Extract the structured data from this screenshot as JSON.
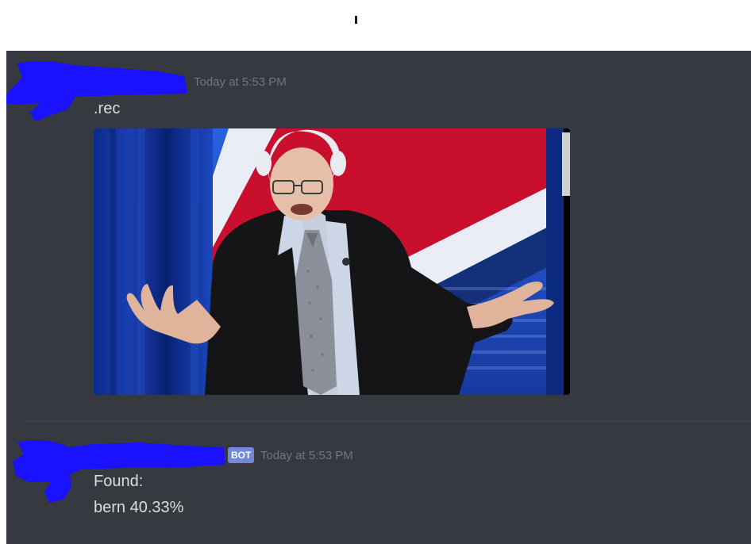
{
  "messages": [
    {
      "author": "",
      "timestamp": "Today at 5:53 PM",
      "text": ".rec",
      "attachment": {
        "kind": "photo",
        "subject": "speaker at a town hall stage"
      }
    },
    {
      "author": "",
      "badge": "BOT",
      "timestamp": "Today at 5:53 PM",
      "lines": [
        "Found:",
        "bern 40.33%"
      ]
    }
  ],
  "colors": {
    "background": "#36393f",
    "text": "#dcddde",
    "muted": "#72767d",
    "bot_badge": "#7289da",
    "redaction": "#1a12ff"
  }
}
